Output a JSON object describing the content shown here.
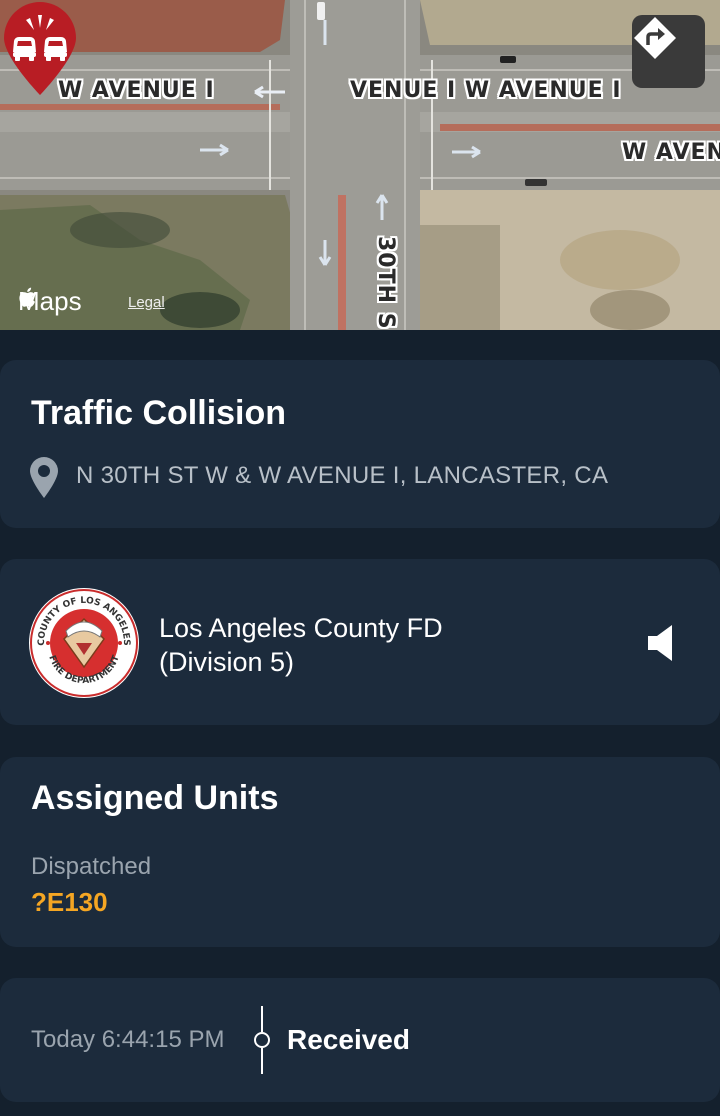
{
  "map": {
    "road_labels": {
      "w_avenue_i_left": "W AVENUE I",
      "w_avenue_i_mid": "VENUE I  W AVENUE I",
      "w_aven_right": "W AVEN",
      "street_30th": "30TH S"
    },
    "brand": "Maps",
    "legal": "Legal",
    "icons": {
      "directions": "directions-arrow-icon",
      "incident_pin": "car-collision-pin-icon",
      "apple": "apple-logo-icon"
    },
    "colors": {
      "pin": "#b81d24"
    }
  },
  "incident": {
    "title": "Traffic Collision",
    "address": "N 30TH ST W & W AVENUE I, LANCASTER, CA",
    "address_icon": "location-pin-icon"
  },
  "agency": {
    "name_line1": "Los Angeles County FD",
    "name_line2": "(Division 5)",
    "seal": {
      "top_text": "COUNTY OF LOS ANGELES",
      "bottom_text": "FIRE DEPARTMENT"
    },
    "audio_icon": "speaker-icon"
  },
  "units": {
    "heading": "Assigned Units",
    "status_label": "Dispatched",
    "unit_id": "?E130",
    "colors": {
      "unit": "#f5a623"
    }
  },
  "timeline": {
    "time": "Today 6:44:15 PM",
    "event": "Received"
  }
}
